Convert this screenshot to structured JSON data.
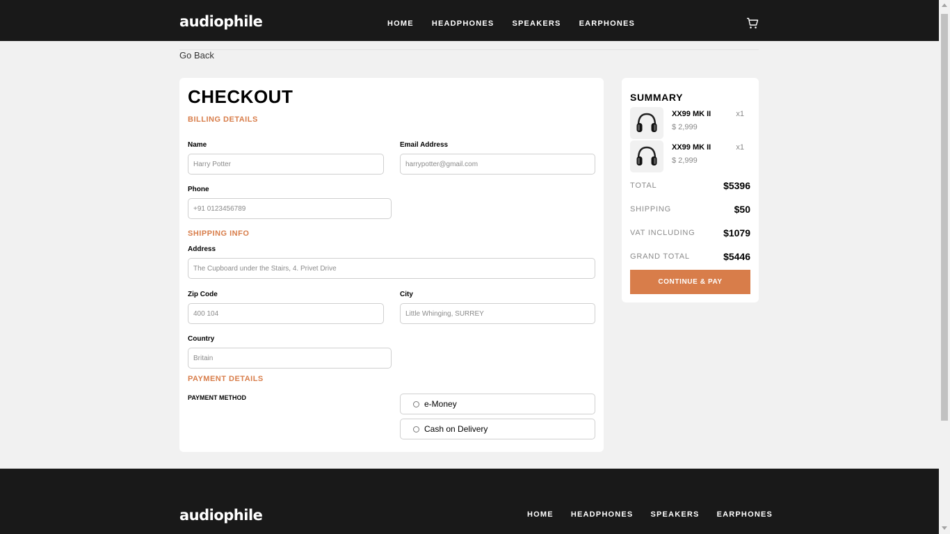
{
  "header": {
    "logo": "audiophile",
    "nav": [
      "HOME",
      "HEADPHONES",
      "SPEAKERS",
      "EARPHONES"
    ],
    "cart_icon": "cart-icon"
  },
  "go_back": "Go Back",
  "checkout": {
    "title": "CHECKOUT",
    "billing_title": "BILLING DETAILS",
    "name_label": "Name",
    "name_placeholder": "Harry Potter",
    "email_label": "Email Address",
    "email_placeholder": "harrypotter@gmail.com",
    "phone_label": "Phone",
    "phone_placeholder": "+91 0123456789",
    "shipping_title": "SHIPPING INFO",
    "address_label": "Address",
    "address_placeholder": "The Cupboard under the Stairs, 4. Privet Drive",
    "zip_label": "Zip Code",
    "zip_placeholder": "400 104",
    "city_label": "City",
    "city_placeholder": "Little Whinging, SURREY",
    "country_label": "Country",
    "country_placeholder": "Britain",
    "payment_title": "PAYMENT DETAILS",
    "payment_method_label": "PAYMENT METHOD",
    "payment_options": [
      "e-Money",
      "Cash on Delivery"
    ]
  },
  "summary": {
    "title": "SUMMARY",
    "items": [
      {
        "name": "XX99 MK II",
        "price": "$ 2,999",
        "qty": "x1",
        "icon": "headphones-icon"
      },
      {
        "name": "XX99 MK II",
        "price": "$ 2,999",
        "qty": "x1",
        "icon": "headphones-icon"
      }
    ],
    "rows": [
      {
        "label": "TOTAL",
        "value": "$5396"
      },
      {
        "label": "SHIPPING",
        "value": "$50"
      },
      {
        "label": "VAT INCLUDING",
        "value": "$1079"
      },
      {
        "label": "GRAND TOTAL",
        "value": "$5446"
      }
    ],
    "pay_button": "CONTINUE & PAY"
  },
  "footer": {
    "logo": "audiophile",
    "nav": [
      "HOME",
      "HEADPHONES",
      "SPEAKERS",
      "EARPHONES"
    ]
  },
  "colors": {
    "accent": "#d87d4a",
    "dark": "#191919",
    "background": "#f1f1f1"
  }
}
